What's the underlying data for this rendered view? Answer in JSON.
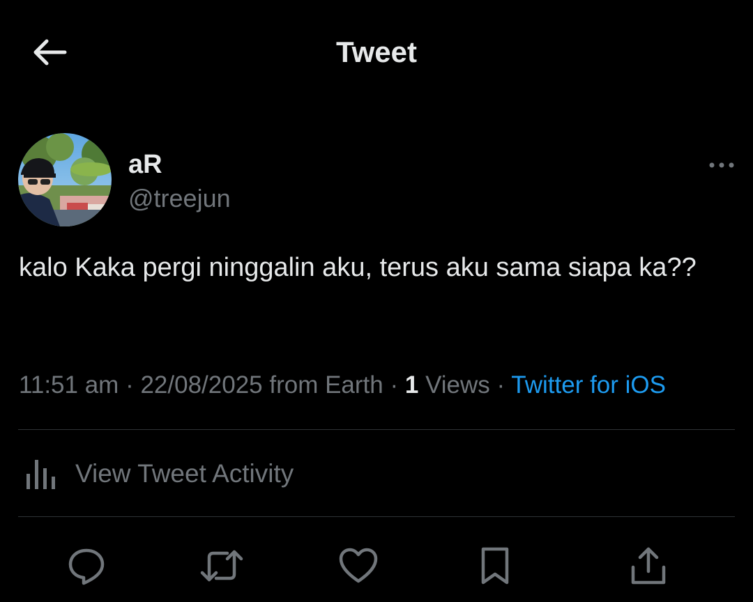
{
  "header": {
    "title": "Tweet",
    "back_icon": "arrow-left-icon"
  },
  "tweet": {
    "author": {
      "display_name": "aR",
      "handle": "@treejun"
    },
    "text": "kalo Kaka pergi ninggalin aku, terus aku sama siapa ka??",
    "time": "11:51 am",
    "date": "22/08/2025",
    "location": "from Earth",
    "separator": " · ",
    "views_count": "1",
    "views_label": "Views",
    "source": "Twitter for iOS"
  },
  "activity": {
    "label": "View Tweet Activity",
    "icon": "bar-chart-icon"
  },
  "actions": [
    {
      "name": "reply",
      "icon": "reply-icon"
    },
    {
      "name": "retweet",
      "icon": "retweet-icon"
    },
    {
      "name": "like",
      "icon": "heart-icon"
    },
    {
      "name": "bookmark",
      "icon": "bookmark-icon"
    },
    {
      "name": "share",
      "icon": "share-icon"
    }
  ],
  "colors": {
    "background": "#000000",
    "text_primary": "#e7e9ea",
    "text_secondary": "#71767b",
    "accent": "#1d9bf0",
    "divider": "#2f3336"
  }
}
